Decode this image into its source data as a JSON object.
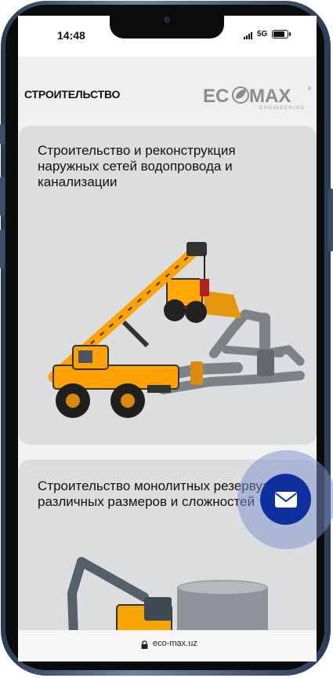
{
  "status_bar": {
    "time": "14:48",
    "network": "5G",
    "signal_icon": "signal-bars-icon",
    "battery_icon": "battery-icon"
  },
  "header": {
    "section_title": "СТРОИТЕЛЬСТВО",
    "logo": {
      "text": "ECOMAX",
      "tagline": "ENGINEERING",
      "color": "#8c8c8c"
    }
  },
  "cards": [
    {
      "title": "Строительство и реконструкция наружных сетей водопровода и канализации",
      "image": "crane-and-pipes-illustration"
    },
    {
      "title": "Строительство монолитных резервуаров\nразличных размеров и сложностей",
      "image": "excavator-and-tank-illustration"
    }
  ],
  "fab": {
    "icon": "envelope-icon",
    "color": "#0f2f9e"
  },
  "browser": {
    "url": "eco-max.uz",
    "lock_icon": "lock-icon"
  }
}
